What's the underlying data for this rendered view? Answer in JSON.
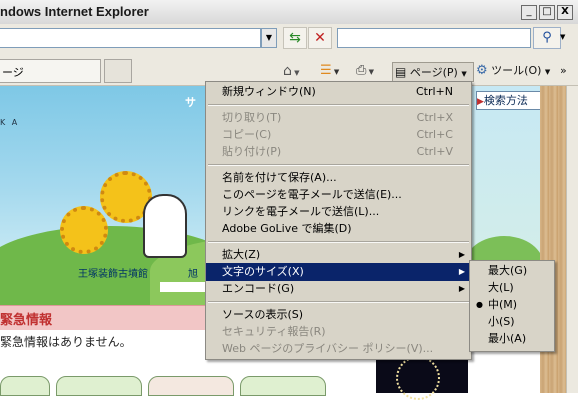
{
  "window": {
    "title": "ndows Internet Explorer",
    "minimize": "_",
    "maximize": "□",
    "close": "X"
  },
  "address_bar": {
    "url": "",
    "refresh_icon": "refresh-icon",
    "stop_icon": "stop-icon"
  },
  "search": {
    "value": ""
  },
  "tab": {
    "label": "ージ"
  },
  "command_bar": {
    "page_label": "ページ(P)",
    "tools_label": "ツール(O)"
  },
  "page_content": {
    "hero_letter": "サ",
    "hero_small": "K A",
    "caption_1": "王塚装飾古墳館",
    "caption_2": "旭",
    "alert_title": "緊急情報",
    "alert_body": "緊急情報はありません。",
    "howto_button": "検索方法"
  },
  "page_menu": {
    "items": [
      {
        "label": "新規ウィンドウ(N)",
        "shortcut": "Ctrl+N",
        "disabled": false
      },
      {
        "label": "切り取り(T)",
        "shortcut": "Ctrl+X",
        "disabled": true
      },
      {
        "label": "コピー(C)",
        "shortcut": "Ctrl+C",
        "disabled": true
      },
      {
        "label": "貼り付け(P)",
        "shortcut": "Ctrl+V",
        "disabled": true
      },
      {
        "label": "名前を付けて保存(A)...",
        "shortcut": "",
        "disabled": false
      },
      {
        "label": "このページを電子メールで送信(E)...",
        "shortcut": "",
        "disabled": false
      },
      {
        "label": "リンクを電子メールで送信(L)...",
        "shortcut": "",
        "disabled": false
      },
      {
        "label": "Adobe GoLive で編集(D)",
        "shortcut": "",
        "disabled": false
      },
      {
        "label": "拡大(Z)",
        "shortcut": "",
        "disabled": false
      },
      {
        "label": "文字のサイズ(X)",
        "shortcut": "",
        "disabled": false
      },
      {
        "label": "エンコード(G)",
        "shortcut": "",
        "disabled": false
      },
      {
        "label": "ソースの表示(S)",
        "shortcut": "",
        "disabled": false
      },
      {
        "label": "セキュリティ報告(R)",
        "shortcut": "",
        "disabled": true
      },
      {
        "label": "Web ページのプライバシー ポリシー(V)...",
        "shortcut": "",
        "disabled": true
      }
    ]
  },
  "text_size_menu": {
    "items": [
      {
        "label": "最大(G)",
        "checked": false
      },
      {
        "label": "大(L)",
        "checked": false
      },
      {
        "label": "中(M)",
        "checked": true
      },
      {
        "label": "小(S)",
        "checked": false
      },
      {
        "label": "最小(A)",
        "checked": false
      }
    ],
    "bullet": "●"
  },
  "colors": {
    "menu_highlight": "#0a246a",
    "menu_bg": "#d8d4c8",
    "alert_text": "#c03030"
  }
}
